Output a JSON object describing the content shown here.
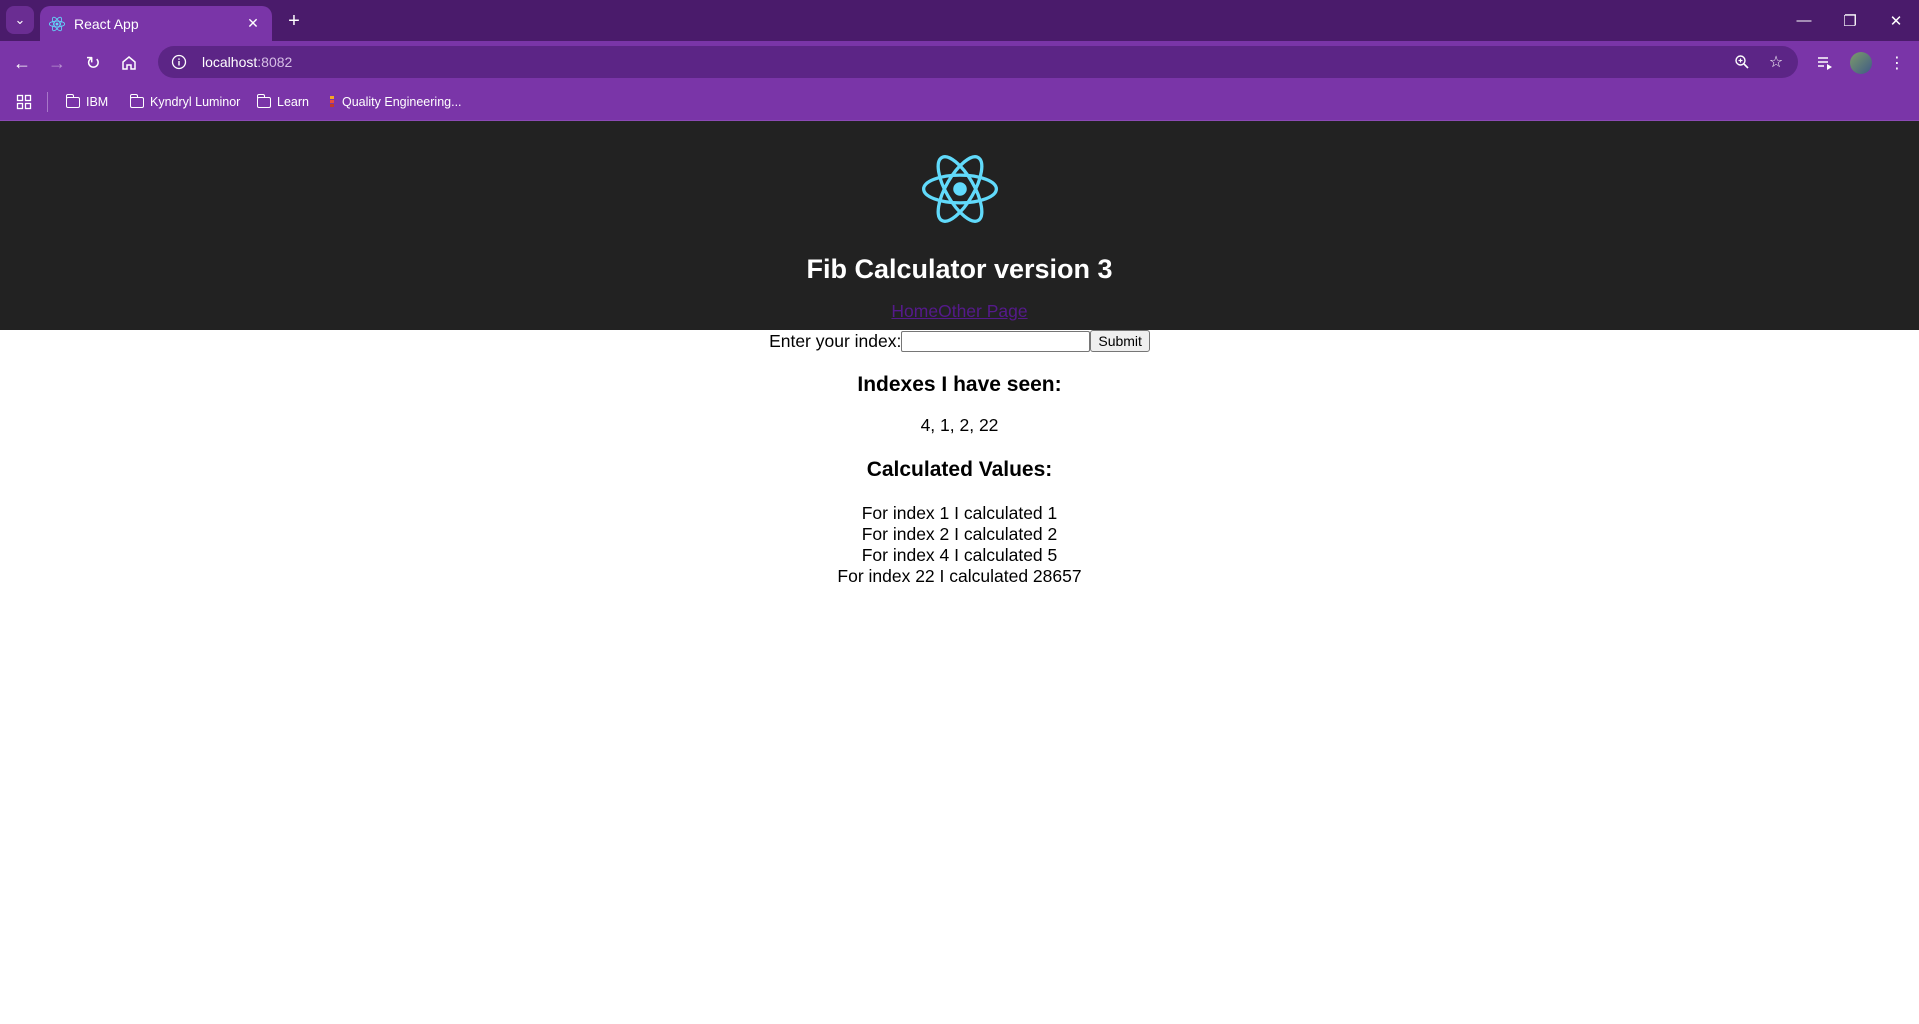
{
  "browser": {
    "tab": {
      "title": "React App"
    },
    "address": {
      "host": "localhost",
      "port": ":8082"
    },
    "bookmarks": [
      {
        "label": "IBM",
        "icon": "folder-icon"
      },
      {
        "label": "Kyndryl Luminor",
        "icon": "folder-icon"
      },
      {
        "label": "Learn",
        "icon": "folder-icon"
      },
      {
        "label": "Quality Engineering...",
        "icon": "bookmark-favicon"
      }
    ],
    "accent_color": "#7a35a8",
    "titlebar_color": "#4a1b6b"
  },
  "page": {
    "header_bg": "#222222",
    "logo_color": "#61dafb",
    "title": "Fib Calculator version 3",
    "links": {
      "home": "Home",
      "other": "Other Page"
    },
    "form": {
      "label": "Enter your index:",
      "value": "",
      "submit": "Submit"
    },
    "seen": {
      "heading": "Indexes I have seen:",
      "values": "4, 1, 2, 22"
    },
    "calculated": {
      "heading": "Calculated Values:",
      "rows": [
        "For index 1 I calculated 1",
        "For index 2 I calculated 2",
        "For index 4 I calculated 5",
        "For index 22 I calculated 28657"
      ]
    }
  }
}
